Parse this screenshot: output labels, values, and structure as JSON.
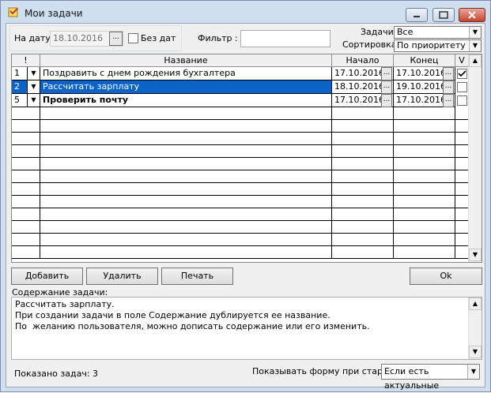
{
  "window": {
    "title": "Мои задачи",
    "accent": "#0a64c8"
  },
  "filters": {
    "date_label": "На дату:",
    "date_value": "18.10.2016",
    "date_button": "...",
    "no_dates_label": "Без дат",
    "filter_label": "Фильтр :",
    "filter_value": "",
    "tasks_label": "Задачи",
    "tasks_selected": "Все",
    "sort_label": "Сортировка",
    "sort_selected": "По приоритету"
  },
  "table": {
    "headers": [
      "!",
      "Название",
      "Начало",
      "Конец",
      "V"
    ],
    "rows": [
      {
        "num": "1",
        "title": "Поздравить с днем рождения  бухгалтера",
        "start": "17.10.2016",
        "end": "17.10.2016",
        "done": true,
        "selected": false,
        "bold": false
      },
      {
        "num": "2",
        "title": "Рассчитать зарплату",
        "start": "18.10.2016",
        "end": "19.10.2016",
        "done": false,
        "selected": true,
        "bold": false
      },
      {
        "num": "5",
        "title": "Проверить почту",
        "start": "17.10.2016",
        "end": "17.10.2016",
        "done": false,
        "selected": false,
        "bold": true
      }
    ],
    "date_button": "..."
  },
  "buttons": {
    "add": "Добавить",
    "delete": "Удалить",
    "print": "Печать",
    "ok": "Ok"
  },
  "content": {
    "label": "Содержание задачи:",
    "lines": [
      "Рассчитать зарплату.",
      "При создании задачи в поле Содержание дублируется ее название.",
      "По  желанию пользователя, можно дописать содержание или его изменить."
    ]
  },
  "footer": {
    "shown_tasks": "Показано задач: 3",
    "show_form_label": "Показывать форму при старте",
    "show_form_selected": "Если есть актуальные"
  }
}
